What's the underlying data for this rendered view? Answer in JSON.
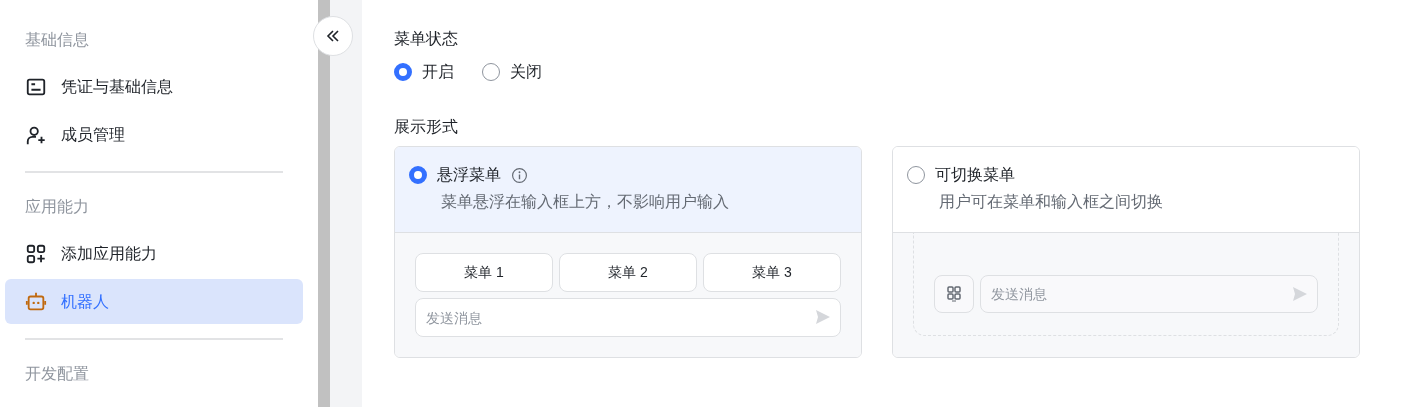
{
  "sidebar": {
    "sections": [
      {
        "heading": "基础信息",
        "items": [
          {
            "label": "凭证与基础信息",
            "selected": false
          },
          {
            "label": "成员管理",
            "selected": false
          }
        ]
      },
      {
        "heading": "应用能力",
        "items": [
          {
            "label": "添加应用能力",
            "selected": false
          },
          {
            "label": "机器人",
            "selected": true
          }
        ]
      },
      {
        "heading": "开发配置"
      }
    ]
  },
  "menu_status": {
    "label": "菜单状态",
    "options": [
      {
        "label": "开启",
        "selected": true
      },
      {
        "label": "关闭",
        "selected": false
      }
    ]
  },
  "display_form": {
    "label": "展示形式",
    "options": [
      {
        "kind": "floating",
        "title": "悬浮菜单",
        "description": "菜单悬浮在输入框上方，不影响用户输入",
        "selected": true,
        "menu_buttons": [
          "菜单 1",
          "菜单 2",
          "菜单 3"
        ],
        "input_placeholder": "发送消息"
      },
      {
        "kind": "switchable",
        "title": "可切换菜单",
        "description": "用户可在菜单和输入框之间切换",
        "selected": false,
        "input_placeholder": "发送消息"
      }
    ]
  }
}
